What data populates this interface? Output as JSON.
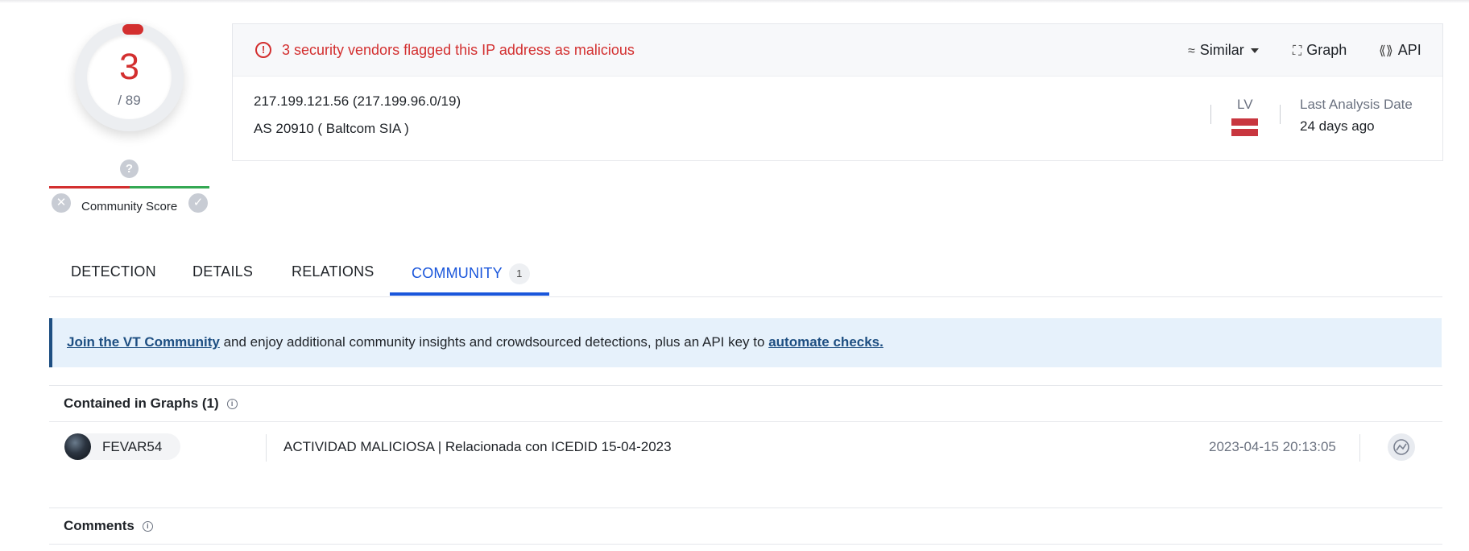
{
  "score": {
    "detections": "3",
    "total": "/ 89"
  },
  "community_score": {
    "label": "Community Score"
  },
  "header": {
    "alert": "3 security vendors flagged this IP address as malicious",
    "actions": {
      "similar": "Similar",
      "graph": "Graph",
      "api": "API"
    },
    "ip": "217.199.121.56  (217.199.96.0/19)",
    "as": "AS 20910  ( Baltcom SIA )",
    "country": "LV",
    "last_analysis_label": "Last Analysis Date",
    "last_analysis_value": "24 days ago"
  },
  "tabs": {
    "detection": "DETECTION",
    "details": "DETAILS",
    "relations": "RELATIONS",
    "community": "COMMUNITY",
    "community_count": "1"
  },
  "banner": {
    "link1": "Join the VT Community",
    "middle": " and enjoy additional community insights and crowdsourced detections, plus an API key to ",
    "link2": "automate checks."
  },
  "graphs": {
    "title": "Contained in Graphs  (1)",
    "items": [
      {
        "user": "FEVAR54",
        "title": "ACTIVIDAD MALICIOSA | Relacionada con ICEDID 15-04-2023",
        "date": "2023-04-15 20:13:05"
      }
    ]
  },
  "comments": {
    "title": "Comments"
  },
  "icons": {
    "alert": "exclamation-circle-icon",
    "similar": "similar-wave-icon",
    "graph": "graph-nodes-icon",
    "api": "api-icon",
    "community_question": "question-icon",
    "downvote": "close-icon",
    "upvote": "check-icon",
    "info": "info-icon",
    "graph_item": "graph-open-icon"
  },
  "colors": {
    "malicious": "#d32f2f",
    "accent": "#1a56db",
    "banner_bg": "#e6f1fb"
  }
}
